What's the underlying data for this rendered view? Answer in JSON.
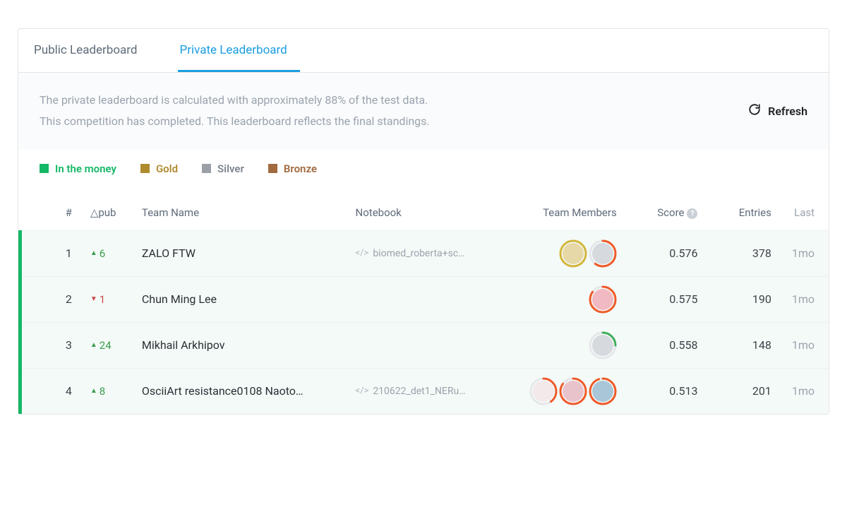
{
  "tabs": {
    "public": "Public Leaderboard",
    "private": "Private Leaderboard"
  },
  "info": {
    "line1": "The private leaderboard is calculated with approximately 88% of the test data.",
    "line2": "This competition has completed. This leaderboard reflects the final standings."
  },
  "refresh_label": "Refresh",
  "legend": {
    "money": "In the money",
    "gold": "Gold",
    "silver": "Silver",
    "bronze": "Bronze"
  },
  "columns": {
    "rank": "#",
    "delta": "△pub",
    "team": "Team Name",
    "notebook": "Notebook",
    "members": "Team Members",
    "score": "Score",
    "entries": "Entries",
    "last": "Last"
  },
  "rows": [
    {
      "rank": "1",
      "delta_dir": "up",
      "delta": "6",
      "team": "ZALO FTW",
      "notebook": "biomed_roberta+sc…",
      "members": [
        {
          "ring": "#d4b63a",
          "pct": 100,
          "bg": "#e7d8a8"
        },
        {
          "ring": "#f05a28",
          "pct": 60,
          "bg": "#d6dade"
        }
      ],
      "score": "0.576",
      "entries": "378",
      "last": "1mo"
    },
    {
      "rank": "2",
      "delta_dir": "down",
      "delta": "1",
      "team": "Chun Ming Lee",
      "notebook": "",
      "members": [
        {
          "ring": "#f05a28",
          "pct": 85,
          "bg": "#f1b9c2"
        }
      ],
      "score": "0.575",
      "entries": "190",
      "last": "1mo"
    },
    {
      "rank": "3",
      "delta_dir": "up",
      "delta": "24",
      "team": "Mikhail Arkhipov",
      "notebook": "",
      "members": [
        {
          "ring": "#3fae5a",
          "pct": 25,
          "bg": "#d6dade"
        }
      ],
      "score": "0.558",
      "entries": "148",
      "last": "1mo"
    },
    {
      "rank": "4",
      "delta_dir": "up",
      "delta": "8",
      "team": "OsciiArt resistance0108 Naoto…",
      "notebook": "210622_det1_NERu…",
      "members": [
        {
          "ring": "#f05a28",
          "pct": 40,
          "bg": "#f3e8ea"
        },
        {
          "ring": "#f05a28",
          "pct": 85,
          "bg": "#e9c3cc"
        },
        {
          "ring": "#f05a28",
          "pct": 95,
          "bg": "#a9c6d8"
        }
      ],
      "score": "0.513",
      "entries": "201",
      "last": "1mo"
    }
  ]
}
